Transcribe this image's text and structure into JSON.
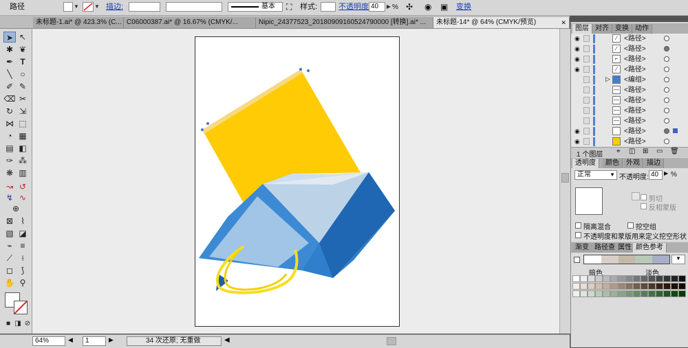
{
  "control_bar": {
    "object_type": "路径",
    "stroke_label": "描边:",
    "brush_label": "基本",
    "style_label": "样式:",
    "opacity_label": "不透明度",
    "opacity_value": "40",
    "opacity_unit": "%",
    "transform_label": "变换"
  },
  "tabs": [
    {
      "label": "未标题-1.ai* @ 423.3% (C..."
    },
    {
      "label": "C06000387.ai* @ 16.67% (CMYK/..."
    },
    {
      "label": "Nipic_24377523_20180909160524790000 [转换].ai* ..."
    },
    {
      "label": "未标题-14* @ 64% (CMYK/预览)"
    }
  ],
  "status_bar": {
    "zoom": "64%",
    "page": "1",
    "undo_text": "34 次还原; 无重做"
  },
  "layers_panel": {
    "tabs": [
      "图层",
      "对齐",
      "变换",
      "动作"
    ],
    "rows": [
      {
        "label": "<路径>",
        "visible": true,
        "target_filled": false
      },
      {
        "label": "<路径>",
        "visible": true,
        "target_filled": true
      },
      {
        "label": "<路径>",
        "visible": true,
        "target_filled": false
      },
      {
        "label": "<路径>",
        "visible": true,
        "target_filled": false
      },
      {
        "label": "<编组>",
        "visible": false,
        "target_filled": false
      },
      {
        "label": "<路径>",
        "visible": false,
        "target_filled": false
      },
      {
        "label": "<路径>",
        "visible": false,
        "target_filled": false
      },
      {
        "label": "<路径>",
        "visible": false,
        "target_filled": false
      },
      {
        "label": "<路径>",
        "visible": false,
        "target_filled": false
      },
      {
        "label": "<路径>",
        "visible": true,
        "target_filled": true
      },
      {
        "label": "<路径>",
        "visible": true,
        "target_filled": false
      }
    ],
    "footer": "1 个图层"
  },
  "transparency_panel": {
    "tabs": [
      "透明度",
      "颜色",
      "外观",
      "描边"
    ],
    "blend_mode": "正常",
    "opacity_label": "不透明度:",
    "opacity_value": "40",
    "opacity_unit": "%",
    "clip_label": "剪切",
    "invert_mask_label": "反相蒙版",
    "isolate_label": "隔离混合",
    "knockout_label": "挖空组",
    "opacity_mask_label": "不透明度和蒙版用来定义挖空形状"
  },
  "color_guide_panel": {
    "tabs": [
      "渐变",
      "路径查",
      "属性",
      "颜色参考"
    ],
    "dark_label": "暗色",
    "light_label": "淡色"
  },
  "colors": {
    "yellow": "#FFCB05",
    "blue": "#2F7FCC",
    "selection": "#4A6FD8"
  }
}
